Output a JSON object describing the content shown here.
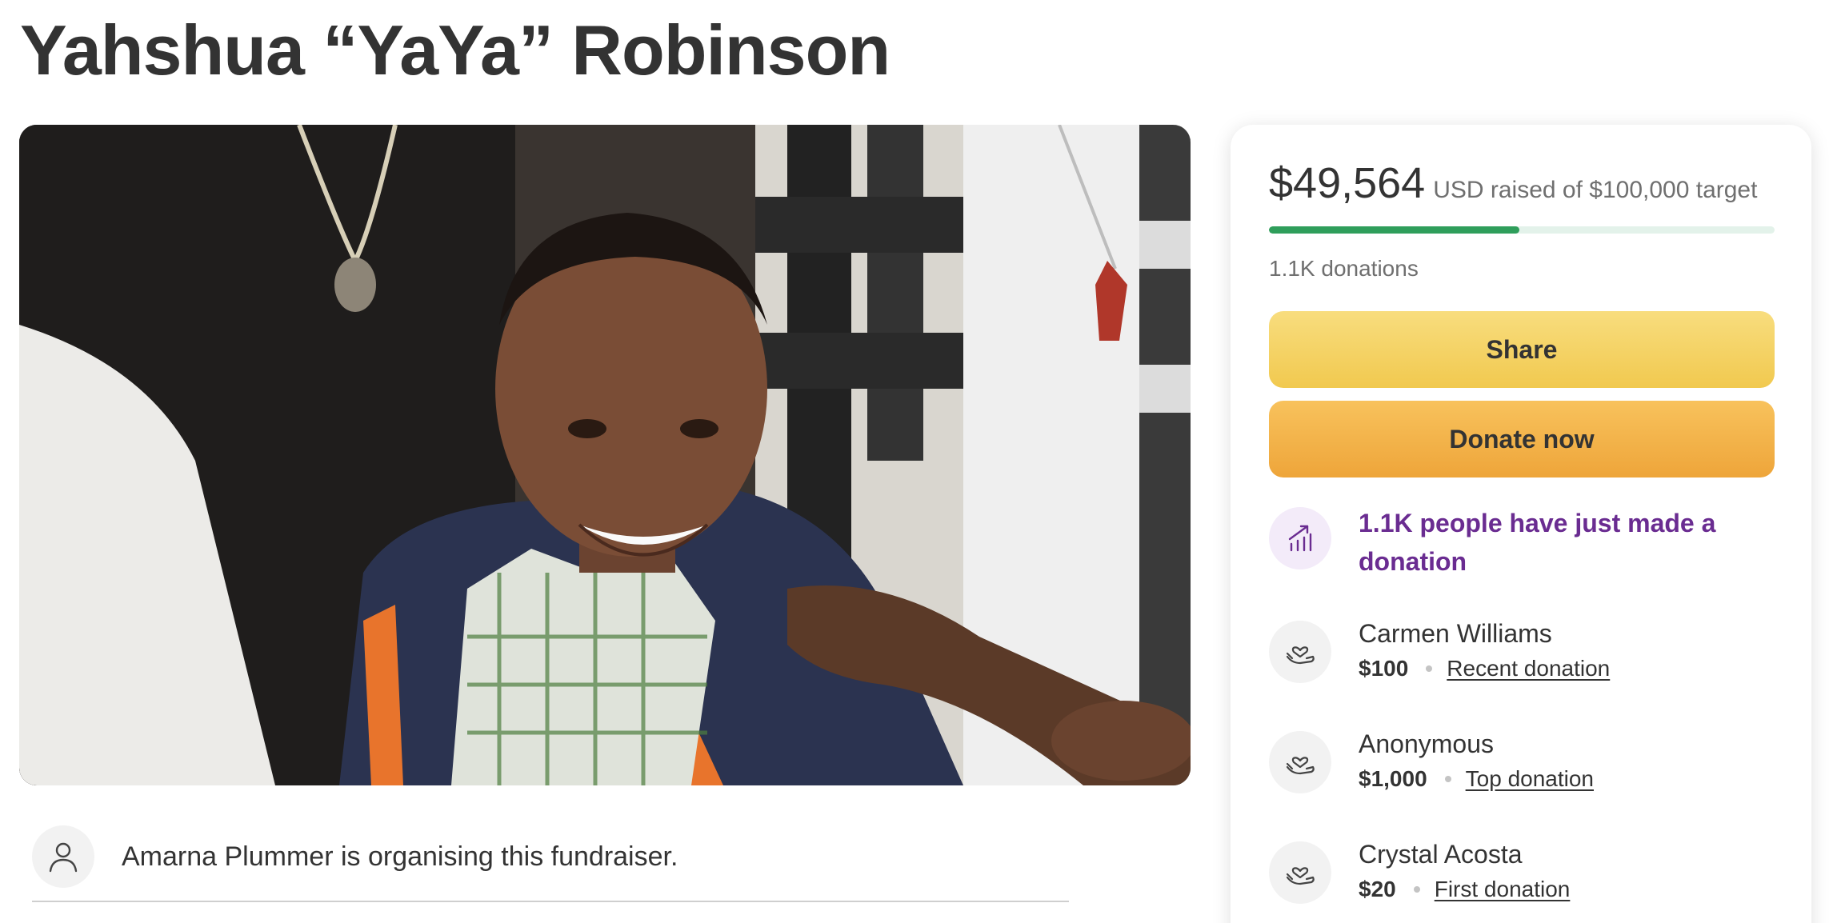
{
  "page": {
    "title": "Yahshua “YaYa” Robinson"
  },
  "organiser": {
    "text": "Amarna Plummer is organising this fundraiser.",
    "icon": "person-icon"
  },
  "stats": {
    "raised": "$49,564",
    "raised_suffix": "USD raised of $100,000 target",
    "progress_fraction": 0.4956,
    "donation_count": "1.1K donations"
  },
  "actions": {
    "share_label": "Share",
    "donate_label": "Donate now"
  },
  "trend": {
    "text": "1.1K people have just made a donation",
    "icon": "trending-chart-icon"
  },
  "donors": [
    {
      "name": "Carmen Williams",
      "amount": "$100",
      "tag": "Recent donation",
      "icon": "heart-hand-icon"
    },
    {
      "name": "Anonymous",
      "amount": "$1,000",
      "tag": "Top donation",
      "icon": "heart-hand-icon"
    },
    {
      "name": "Crystal Acosta",
      "amount": "$20",
      "tag": "First donation",
      "icon": "heart-hand-icon"
    }
  ],
  "colors": {
    "progress": "#2f9e5b",
    "progress_track": "#e3f2ea",
    "share_button": "#f1c94f",
    "donate_button": "#eea53a",
    "trend_text": "#6a2c91"
  }
}
